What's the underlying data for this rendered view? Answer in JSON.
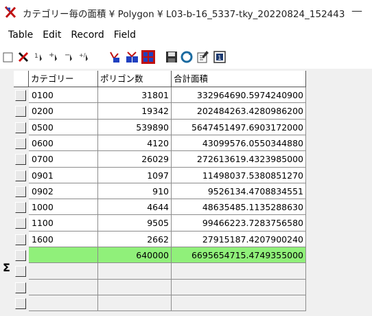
{
  "window": {
    "title": "カテゴリー毎の面積 ¥ Polygon ¥ L03-b-16_5337-tky_20220824_152443",
    "minimize_glyph": "—"
  },
  "menu": [
    "Table",
    "Edit",
    "Record",
    "Field"
  ],
  "toolbar_icons": [
    "checkbox-icon",
    "delete-icon",
    "sort-ascending-icon",
    "add-record-icon",
    "remove-record-icon",
    "calculate-icon",
    "filter-icon",
    "join-icon",
    "select-all-icon",
    "save-icon",
    "refresh-icon",
    "edit-icon",
    "statistics-icon"
  ],
  "table": {
    "headers": [
      "カテゴリー",
      "ポリゴン数",
      "合計面積"
    ],
    "rows": [
      [
        "0100",
        "31801",
        "332964690.5974240900"
      ],
      [
        "0200",
        "19342",
        "202484263.4280986200"
      ],
      [
        "0500",
        "539890",
        "5647451497.6903172000"
      ],
      [
        "0600",
        "4120",
        "43099576.0550344880"
      ],
      [
        "0700",
        "26029",
        "272613619.4323985000"
      ],
      [
        "0901",
        "1097",
        "11498037.5380851270"
      ],
      [
        "0902",
        "910",
        "9526134.4708834551"
      ],
      [
        "1000",
        "4644",
        "48635485.1135288630"
      ],
      [
        "1100",
        "9505",
        "99466223.7283756580"
      ],
      [
        "1600",
        "2662",
        "27915187.4207900240"
      ]
    ],
    "sum_symbol": "Σ",
    "sum_row": [
      "",
      "640000",
      "6695654715.4749355000"
    ]
  },
  "colors": {
    "sum_row_bg": "#90f07a",
    "grid_line": "#8c8c8c"
  }
}
